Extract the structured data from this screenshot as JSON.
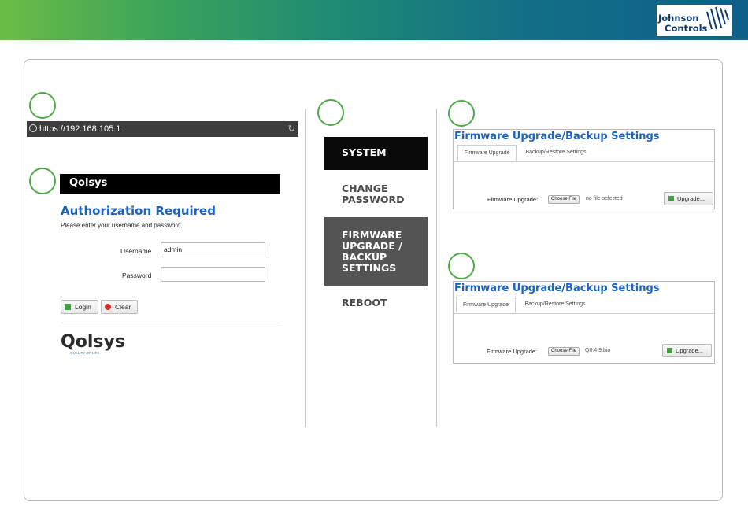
{
  "brand": {
    "line1": "Johnson",
    "line2": "Controls"
  },
  "steps": [
    "",
    "",
    "",
    "",
    ""
  ],
  "browser": {
    "url": "https://192.168.105.1"
  },
  "login": {
    "logo_text": "Qolsys",
    "title": "Authorization Required",
    "subtitle": "Please enter your username and password.",
    "username_label": "Username",
    "username_value": "admin",
    "password_label": "Password",
    "password_value": "",
    "login_button": "Login",
    "clear_button": "Clear",
    "footer_logo": "Qolsys",
    "footer_tagline": "QUALITY OF LIFE"
  },
  "menu": {
    "system": "SYSTEM",
    "change_password": [
      "CHANGE",
      "PASSWORD"
    ],
    "firmware": [
      "FIRMWARE",
      "UPGRADE /",
      "BACKUP",
      "SETTINGS"
    ],
    "reboot": "REBOOT"
  },
  "panel_top": {
    "title": "Firmware Upgrade/Backup Settings",
    "tabs": [
      "Firmware Upgrade",
      "Backup/Restore Settings"
    ],
    "field_label": "Firmware Upgrade:",
    "choose_label": "Choose File",
    "file_status": "no file selected",
    "upgrade_label": "Upgrade..."
  },
  "panel_bottom": {
    "title": "Firmware Upgrade/Backup Settings",
    "tabs": [
      "Firmware Upgrade",
      "Backup/Restore Settings"
    ],
    "field_label": "Firmware Upgrade:",
    "choose_label": "Choose File",
    "file_status": "Q0.4.9.bin",
    "upgrade_label": "Upgrade..."
  },
  "colors": {
    "accent_green": "#4faa45",
    "link_blue": "#1b63c2",
    "dark_menu": "#0a0a0a",
    "mid_menu": "#545454"
  }
}
